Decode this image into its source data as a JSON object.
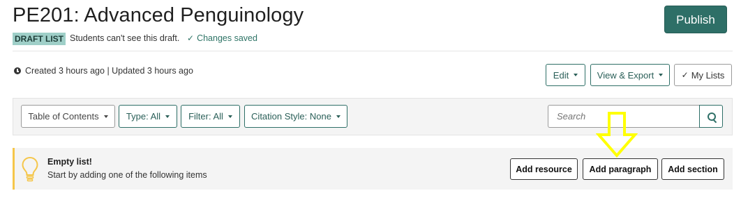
{
  "header": {
    "title": "PE201: Advanced Penguinology",
    "badge": "DRAFT LIST",
    "draft_note": "Students can't see this draft.",
    "saved_status": "Changes saved",
    "publish_label": "Publish"
  },
  "meta": {
    "created_updated": "Created 3 hours ago | Updated 3 hours ago"
  },
  "actions": {
    "edit": "Edit",
    "view_export": "View & Export",
    "my_lists": "My Lists"
  },
  "toolbar": {
    "table_of_contents": "Table of Contents",
    "type": "Type: All",
    "filter": "Filter: All",
    "citation_style": "Citation Style: None",
    "search_placeholder": "Search"
  },
  "empty_state": {
    "title": "Empty list!",
    "subtitle": "Start by adding one of the following items",
    "add_resource": "Add resource",
    "add_paragraph": "Add paragraph",
    "add_section": "Add section"
  },
  "colors": {
    "accent": "#2e6f67",
    "badge_bg": "#9fcfc8",
    "highlight_arrow": "#ffff00",
    "empty_border": "#f5c64a"
  }
}
